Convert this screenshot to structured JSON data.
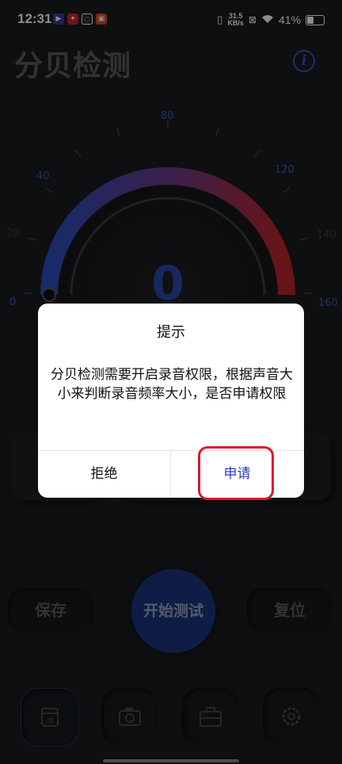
{
  "status_bar": {
    "time": "12:31",
    "net_speed_value": "31.5",
    "net_speed_unit": "KB/s",
    "battery": "41%"
  },
  "app": {
    "title": "分贝检测"
  },
  "gauge": {
    "value": "0",
    "min": 0,
    "max": 160,
    "tick_labels": [
      "0",
      "20",
      "40",
      "80",
      "120",
      "140",
      "160"
    ]
  },
  "actions": {
    "save": "保存",
    "start": "开始测试",
    "reset": "复位"
  },
  "dialog": {
    "title": "提示",
    "message": "分贝检测需要开启录音权限，根据声音大小来判断录音频率大小，是否申请权限",
    "deny": "拒绝",
    "apply": "申请"
  },
  "colors": {
    "accent_blue": "#2d57c8",
    "gauge_red": "#c0262b",
    "apply_text": "#2b3cc4",
    "highlight": "#e0172c"
  },
  "nav_icons": [
    "db-meter-icon",
    "camera-icon",
    "toolbox-icon",
    "settings-icon"
  ]
}
